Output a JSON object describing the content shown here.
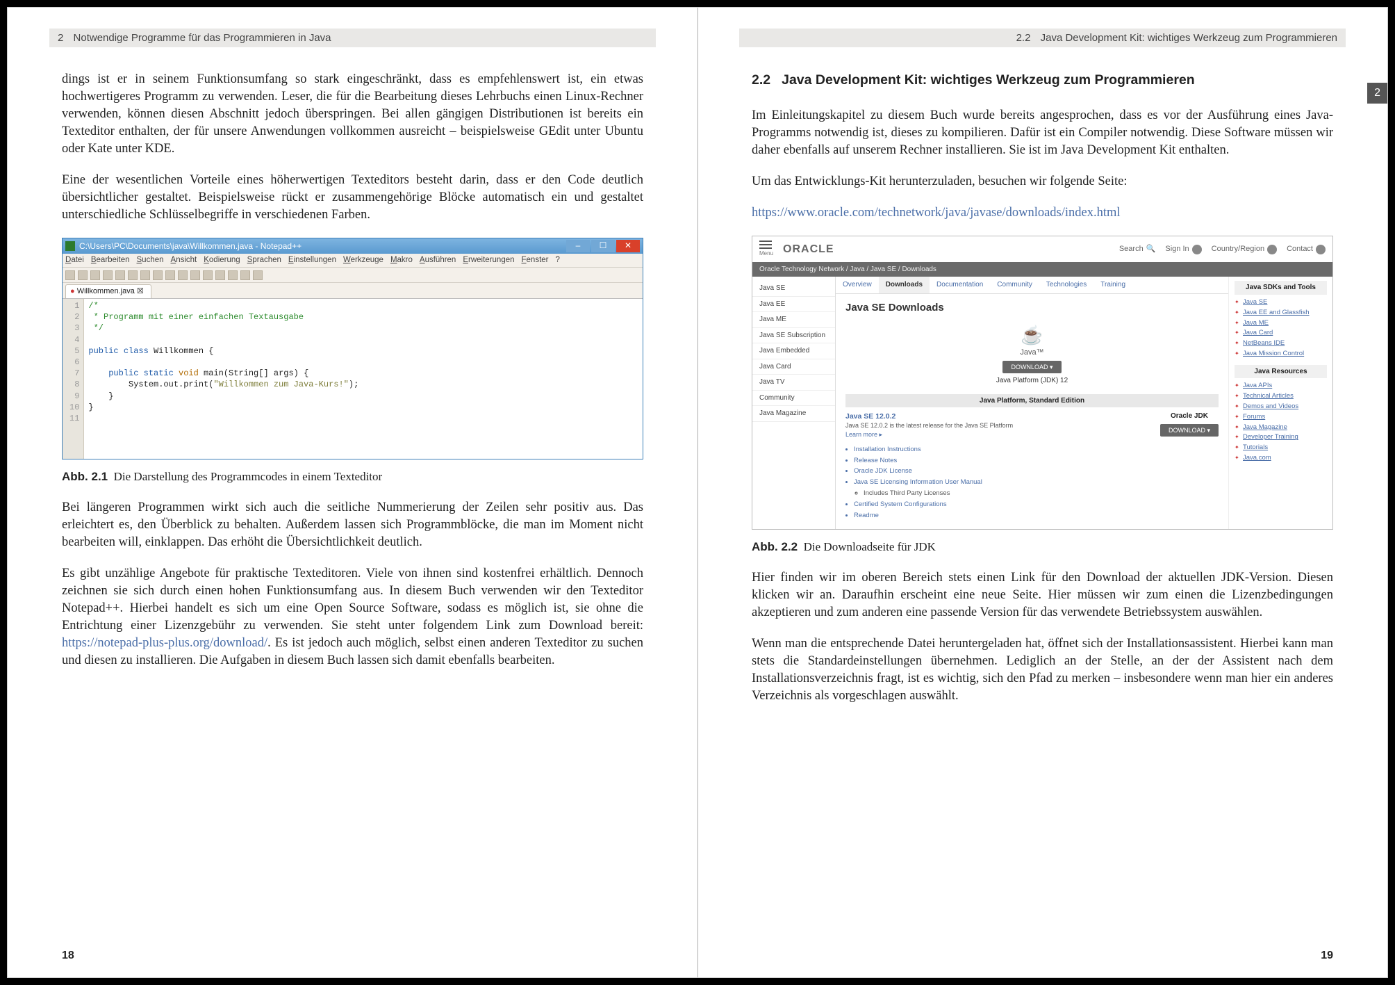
{
  "left": {
    "runningHead": {
      "chapNum": "2",
      "chapTitle": "Notwendige Programme für das Programmieren in Java"
    },
    "para1": "dings ist er in seinem Funktionsumfang so stark eingeschränkt, dass es empfehlenswert ist, ein etwas hochwertigeres Programm zu verwenden. Leser, die für die Bearbeitung dieses Lehrbuchs einen Linux-Rechner verwenden, können diesen Abschnitt jedoch überspringen. Bei allen gängigen Distributionen ist bereits ein Texteditor enthalten, der für unsere Anwendungen vollkommen ausreicht – beispielsweise GEdit unter Ubuntu oder Kate unter KDE.",
    "para2": "Eine der wesentlichen Vorteile eines höherwertigen Texteditors besteht darin, dass er den Code deutlich übersichtlicher gestaltet. Beispielsweise rückt er zusammengehörige Blöcke automatisch ein und gestaltet unterschiedliche Schlüsselbegriffe in verschiedenen Farben.",
    "fig1Caption": {
      "label": "Abb. 2.1",
      "text": "Die Darstellung des Programmcodes in einem Texteditor"
    },
    "para3": "Bei längeren Programmen wirkt sich auch die seitliche Nummerierung der Zeilen sehr positiv aus. Das erleichtert es, den Überblick zu behalten. Außerdem lassen sich Programmblöcke, die man im Moment nicht bearbeiten will, einklappen. Das erhöht die Übersichtlichkeit deutlich.",
    "para4a": "Es gibt unzählige Angebote für praktische Texteditoren. Viele von ihnen sind kostenfrei erhältlich. Dennoch zeichnen sie sich durch einen hohen Funktionsumfang aus. In diesem Buch verwenden wir den Texteditor Notepad++. Hierbei handelt es sich um eine Open Source Software, sodass es möglich ist, sie ohne die Entrichtung einer Lizenzgebühr zu verwenden. Sie steht unter folgendem Link zum Download bereit: ",
    "para4link": "https://notepad-plus-plus.org/download/",
    "para4b": ". Es ist jedoch auch möglich, selbst einen anderen Texteditor zu suchen und diesen zu installieren. Die Aufgaben in diesem Buch lassen sich damit ebenfalls bearbeiten.",
    "pageNum": "18",
    "editor": {
      "title": "C:\\Users\\PC\\Documents\\java\\Willkommen.java - Notepad++",
      "menus": [
        "Datei",
        "Bearbeiten",
        "Suchen",
        "Ansicht",
        "Kodierung",
        "Sprachen",
        "Einstellungen",
        "Werkzeuge",
        "Makro",
        "Ausführen",
        "Erweiterungen",
        "Fenster",
        "?"
      ],
      "tab": "Willkommen.java",
      "lines": [
        "1",
        "2",
        "3",
        "4",
        "5",
        "6",
        "7",
        "8",
        "9",
        "10",
        "11"
      ],
      "code": {
        "l1": "/*",
        "l2": " * Programm mit einer einfachen Textausgabe",
        "l3": " */",
        "l4": "",
        "l5_a": "public class",
        "l5_b": " Willkommen {",
        "l6": "",
        "l7_a": "    public static ",
        "l7_b": "void",
        "l7_c": " main(String[] args) {",
        "l8_a": "        System.out.print(",
        "l8_b": "\"Willkommen zum Java-Kurs!\"",
        "l8_c": ");",
        "l9": "    }",
        "l10": "}"
      }
    }
  },
  "right": {
    "runningHead": {
      "secNum": "2.2",
      "secTitle": "Java Development Kit: wichtiges Werkzeug zum Programmieren"
    },
    "thumbTab": "2",
    "sectionTitle": {
      "num": "2.2",
      "text": "Java Development Kit: wichtiges Werkzeug zum Programmieren"
    },
    "para1": "Im Einleitungskapitel zu diesem Buch wurde bereits angesprochen, dass es vor der Ausführung eines Java-Programms notwendig ist, dieses zu kompilieren. Dafür ist ein Compiler notwendig. Diese Software müssen wir daher ebenfalls auf unserem Rechner installieren. Sie ist im Java Development Kit enthalten.",
    "para2": "Um das Entwicklungs-Kit herunterzuladen, besuchen wir folgende Seite:",
    "link": "https://www.oracle.com/technetwork/java/javase/downloads/index.html",
    "fig2Caption": {
      "label": "Abb. 2.2",
      "text": "Die Downloadseite für JDK"
    },
    "para3": "Hier finden wir im oberen Bereich stets einen Link für den Download der aktuellen JDK-Version. Diesen klicken wir an. Daraufhin erscheint eine neue Seite. Hier müssen wir zum einen die Lizenzbedingungen akzeptieren und zum anderen eine passende Version für das verwendete Betriebssystem auswählen.",
    "para4": "Wenn man die entsprechende Datei heruntergeladen hat, öffnet sich der Installationsassistent. Hierbei kann man stets die Standardeinstellungen übernehmen. Lediglich an der Stelle, an der der Assistent nach dem Installationsverzeichnis fragt, ist es wichtig, sich den Pfad zu merken – insbesondere wenn man hier ein anderes Verzeichnis als vorgeschlagen auswählt.",
    "pageNum": "19",
    "oracle": {
      "menuLabel": "Menu",
      "logo": "ORACLE",
      "topLinks": {
        "search": "Search",
        "signin": "Sign In",
        "country": "Country/Region",
        "contact": "Contact"
      },
      "breadcrumb": "Oracle Technology Network  /  Java  /  Java SE  /  Downloads",
      "leftnav": [
        "Java SE",
        "Java EE",
        "Java ME",
        "Java SE Subscription",
        "Java Embedded",
        "Java Card",
        "Java TV",
        "Community",
        "Java Magazine"
      ],
      "tabs": [
        "Overview",
        "Downloads",
        "Documentation",
        "Community",
        "Technologies",
        "Training"
      ],
      "h1": "Java SE Downloads",
      "javaName": "Java™",
      "dlBtn": "DOWNLOAD ▾",
      "platform": "Java Platform (JDK) 12",
      "stdEdition": "Java Platform, Standard Edition",
      "releaseTitle": "Java SE 12.0.2",
      "releaseDesc": "Java SE 12.0.2 is the latest release for the Java SE Platform",
      "learnMore": "Learn more ▸",
      "jdkBadge": "Oracle JDK",
      "bullets": [
        "Installation Instructions",
        "Release Notes",
        "Oracle JDK License",
        "Java SE Licensing Information User Manual",
        "Includes Third Party Licenses",
        "Certified System Configurations",
        "Readme"
      ],
      "rightHead1": "Java SDKs and Tools",
      "rightLinks1": [
        "Java SE",
        "Java EE and Glassfish",
        "Java ME",
        "Java Card",
        "NetBeans IDE",
        "Java Mission Control"
      ],
      "rightHead2": "Java Resources",
      "rightLinks2": [
        "Java APIs",
        "Technical Articles",
        "Demos and Videos",
        "Forums",
        "Java Magazine",
        "Developer Training",
        "Tutorials",
        "Java.com"
      ]
    }
  }
}
